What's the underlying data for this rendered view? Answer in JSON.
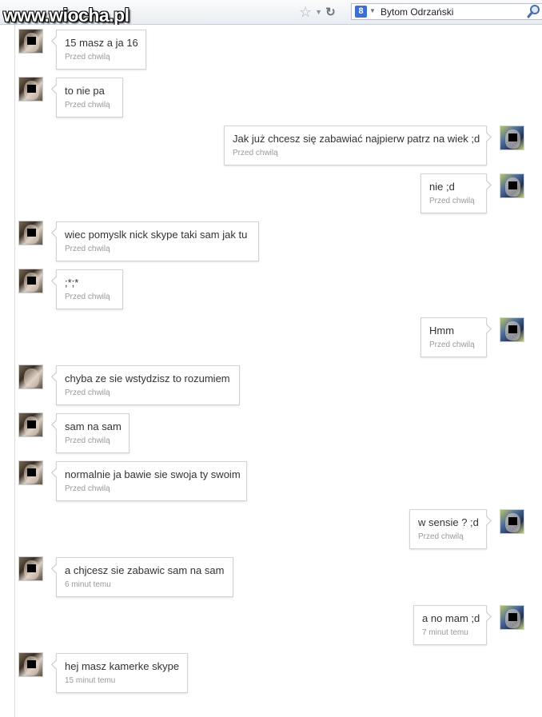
{
  "browser": {
    "watermark": "www.wiocha.pl",
    "search_engine_logo": "8",
    "search_value": "Bytom Odrzański"
  },
  "messages": [
    {
      "side": "them",
      "text": "15 masz a ja 16",
      "time": "Przed chwilą"
    },
    {
      "side": "them",
      "text": "to nie pa",
      "time": "Przed chwilą"
    },
    {
      "side": "me",
      "text": "Jak już chcesz się zabawiać najpierw patrz na wiek ;d",
      "time": "Przed chwilą"
    },
    {
      "side": "me",
      "text": "nie ;d",
      "time": "Przed chwilą"
    },
    {
      "side": "them",
      "text": "wiec pomyslk nick skype taki sam jak tu",
      "time": "Przed chwilą"
    },
    {
      "side": "them",
      "text": ";*;*",
      "time": "Przed chwilą"
    },
    {
      "side": "me",
      "text": "Hmm",
      "time": "Przed chwilą"
    },
    {
      "side": "them",
      "text": "chyba ze sie wstydzisz to rozumiem",
      "time": "Przed chwilą"
    },
    {
      "side": "them",
      "text": "sam na sam",
      "time": "Przed chwilą"
    },
    {
      "side": "them",
      "text": "normalnie ja bawie sie swoja ty swoim",
      "time": "Przed chwilą"
    },
    {
      "side": "me",
      "text": "w sensie ? ;d",
      "time": "Przed chwilą"
    },
    {
      "side": "them",
      "text": "a chjcesz sie zabawic sam na sam",
      "time": "6 minut temu"
    },
    {
      "side": "me",
      "text": "a no mam ;d",
      "time": "7 minut temu"
    },
    {
      "side": "them",
      "text": "hej masz kamerke skype",
      "time": "15 minut temu"
    }
  ],
  "icons": {
    "bookmark": "star-icon",
    "reload": "reload-icon",
    "search": "magnifier-icon"
  }
}
